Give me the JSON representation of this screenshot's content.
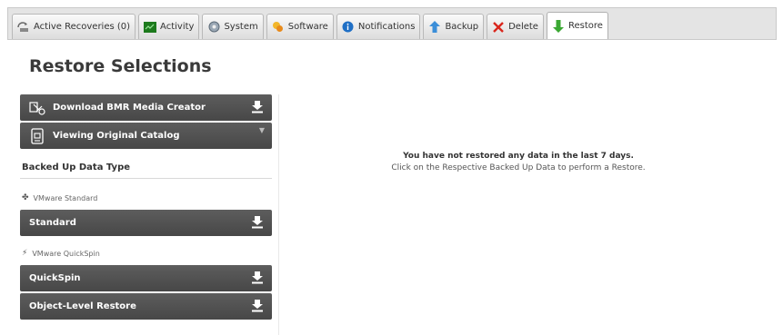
{
  "tabs": [
    {
      "label": "Active Recoveries (0)",
      "icon": "recovery-icon",
      "active": false
    },
    {
      "label": "Activity",
      "icon": "activity-icon",
      "active": false
    },
    {
      "label": "System",
      "icon": "system-icon",
      "active": false
    },
    {
      "label": "Software",
      "icon": "software-icon",
      "active": false
    },
    {
      "label": "Notifications",
      "icon": "notifications-icon",
      "active": false
    },
    {
      "label": "Backup",
      "icon": "backup-icon",
      "active": false
    },
    {
      "label": "Delete",
      "icon": "delete-icon",
      "active": false
    },
    {
      "label": "Restore",
      "icon": "restore-icon",
      "active": true
    }
  ],
  "page": {
    "title": "Restore Selections"
  },
  "left": {
    "bmr_label": "Download BMR Media Creator",
    "catalog_label": "Viewing Original Catalog",
    "section_title": "Backed Up Data Type",
    "vmware_standard": {
      "label": "VMware Standard",
      "button": "Standard"
    },
    "vmware_quickspin": {
      "label": "VMware QuickSpin",
      "buttons": [
        "QuickSpin",
        "Object-Level Restore"
      ]
    }
  },
  "empty": {
    "line1": "You have not restored any data in the last 7 days.",
    "line2": "Click on the Respective Backed Up Data to perform a Restore."
  },
  "colors": {
    "button_bg": "#4f4f4f",
    "delete_x": "#d9261c",
    "restore_arrow": "#3aa832",
    "backup_arrow": "#3b8ed8",
    "notify_blue": "#1f6fc5",
    "activity_green": "#1d7a1d"
  }
}
